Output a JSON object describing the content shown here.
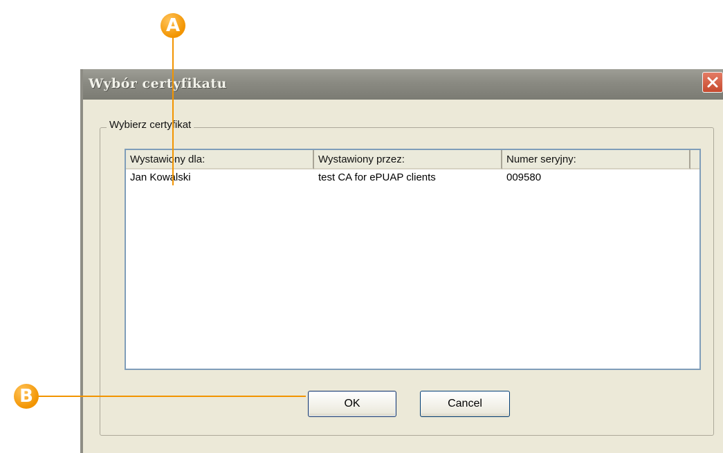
{
  "window": {
    "title": "Wybór certyfikatu"
  },
  "group": {
    "legend": "Wybierz certyfikat"
  },
  "list": {
    "columns": [
      "Wystawiony dla:",
      "Wystawiony przez:",
      "Numer seryjny:"
    ],
    "rows": [
      [
        "Jan Kowalski",
        "test CA for ePUAP clients",
        "009580"
      ]
    ]
  },
  "buttons": {
    "ok": "OK",
    "cancel": "Cancel"
  },
  "callouts": {
    "a": "A",
    "b": "B"
  },
  "colors": {
    "callout": "#f29400",
    "titlebar": "#8a8a82",
    "close": "#c64a2e",
    "dialog_bg": "#ece9d8"
  },
  "icons": {
    "close": "close-icon"
  }
}
